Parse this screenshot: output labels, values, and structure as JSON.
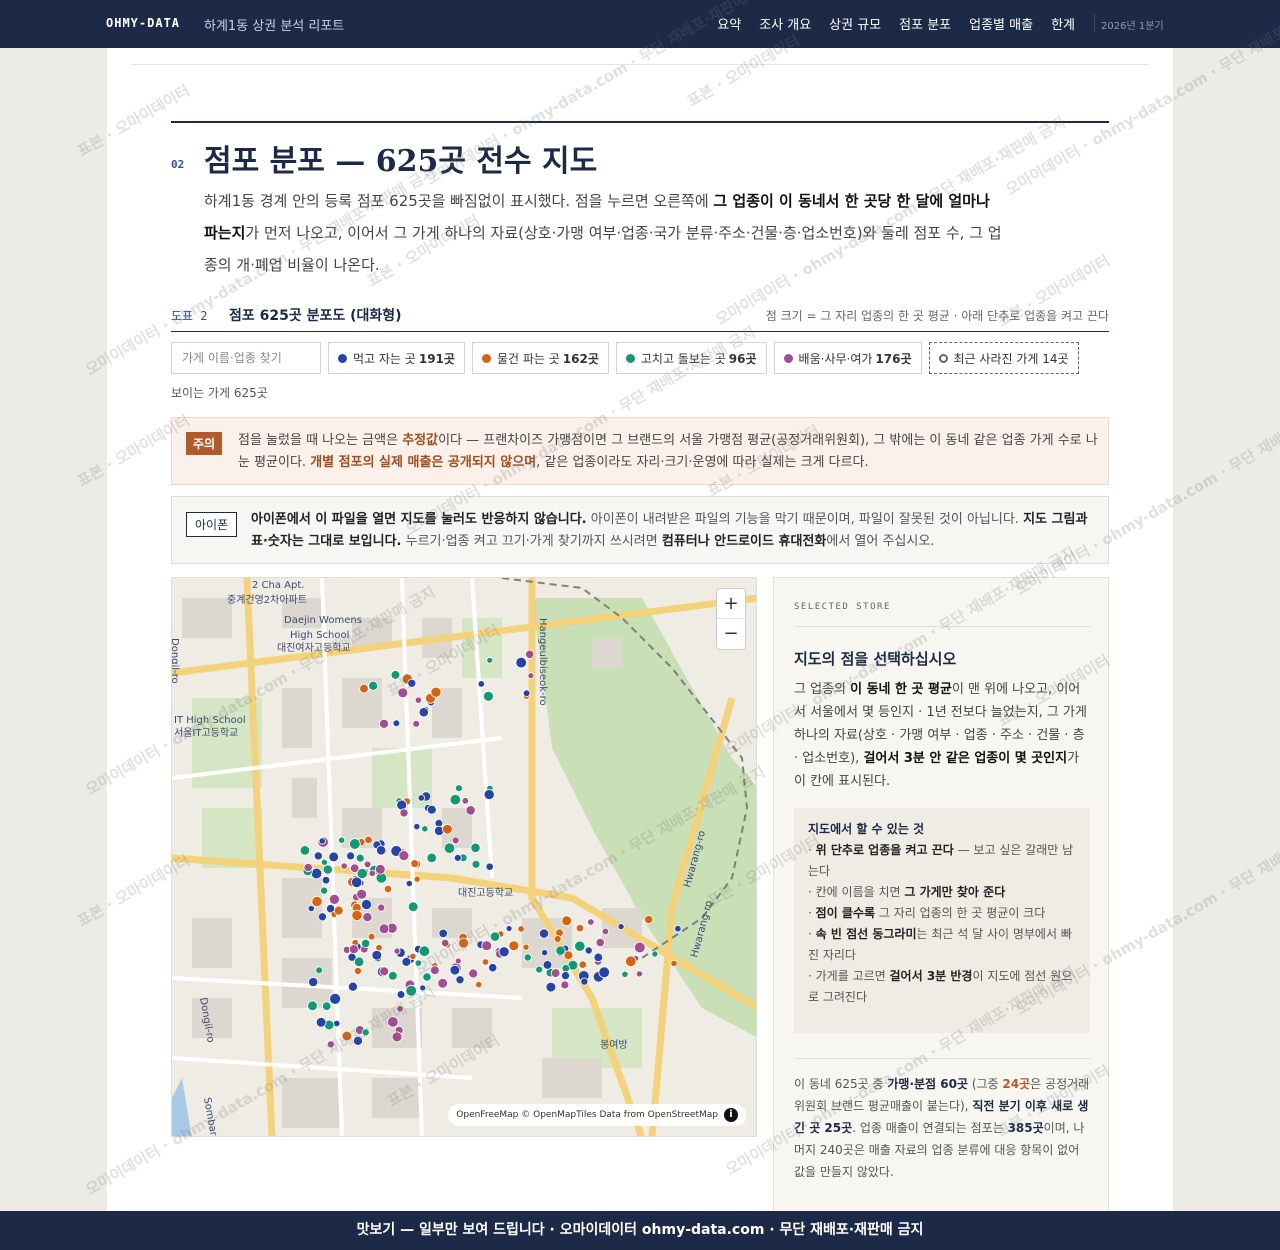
{
  "nav": {
    "brand": "OHMY-DATA",
    "report_title": "하계1동 상권 분석 리포트",
    "items": [
      "요약",
      "조사 개요",
      "상권 규모",
      "점포 분포",
      "업종별 매출",
      "한계"
    ],
    "period": "2026년 1분기"
  },
  "section": {
    "number": "02",
    "title": "점포 분포 — 625곳 전수 지도",
    "desc_1": "하계1동 경계 안의 등록 점포 625곳을 빠짐없이 표시했다. 점을 누르면 오른쪽에 ",
    "desc_bold": "그 업종이 이 동네서 한 곳당 한 달에 얼마나 파는지",
    "desc_2": "가 먼저 나오고, 이어서 그 가게 하나의 자료(상호·가맹 여부·업종·국가 분류·주소·건물·층·업소번호)와 둘레 점포 수, 그 업종의 개·폐업 비율이 나온다."
  },
  "figure": {
    "number": "도표 2",
    "title": "점포 625곳 분포도 (대화형)",
    "note": "점 크기 = 그 자리 업종의 한 곳 평균 · 아래 단추로 업종을 켜고 끈다"
  },
  "filters": {
    "search_placeholder": "가게 이름·업종 찾기",
    "chips": [
      {
        "label": "먹고 자는 곳",
        "count": "191곳",
        "color": "#2644a8"
      },
      {
        "label": "물건 파는 곳",
        "count": "162곳",
        "color": "#d9620f"
      },
      {
        "label": "고치고 돌보는 곳",
        "count": "96곳",
        "color": "#0f9a73"
      },
      {
        "label": "배움·사무·여가",
        "count": "176곳",
        "color": "#a34c90"
      }
    ],
    "closed_chip": "최근 사라진 가게 14곳",
    "visible_count": "보이는 가게 625곳"
  },
  "caution": {
    "tag": "주의",
    "t1": "점을 눌렀을 때 나오는 금액은 ",
    "b1": "추정값",
    "t2": "이다 — 프랜차이즈 가맹점이면 그 브랜드의 서울 가맹점 평균(공정거래위원회), 그 밖에는 이 동네 같은 업종 가게 수로 나눈 평균이다. ",
    "b2": "개별 점포의 실제 매출은 공개되지 않으며",
    "t3": ", 같은 업종이라도 자리·크기·운영에 따라 실제는 크게 다르다."
  },
  "iphone": {
    "tag": "아이폰",
    "b1": "아이폰에서 이 파일을 열면 지도를 눌러도 반응하지 않습니다.",
    "t1": " 아이폰이 내려받은 파일의 기능을 막기 때문이며, 파일이 잘못된 것이 아닙니다. ",
    "b2": "지도 그림과 표·숫자는 그대로 보입니다.",
    "t2": " 누르기·업종 켜고 끄기·가게 찾기까지 쓰시려면 ",
    "b3": "컴퓨터나 안드로이드 휴대전화",
    "t3": "에서 열어 주십시오."
  },
  "map": {
    "labels": [
      "2 Cha Apt.",
      "중계건영2차아파트",
      "Daejin Womens",
      "High School",
      "대진여자고등학교",
      "IT High School",
      "서울IT고등학교",
      "대진고등학교",
      "봉여방",
      "Dongil-ro",
      "Dongil-ro",
      "Sombari-ro",
      "Hwarang-ro",
      "Hwarang-ro",
      "Hangeulbiseok-ro"
    ],
    "zoom_in": "+",
    "zoom_out": "−",
    "attribution": "OpenFreeMap © OpenMapTiles Data from OpenStreetMap",
    "info": "i"
  },
  "side": {
    "label": "SELECTED STORE",
    "title": "지도의 점을 선택하십시오",
    "d1": "그 업종의 ",
    "db1": "이 동네 한 곳 평균",
    "d2": "이 맨 위에 나오고, 이어서 서울에서 몇 등인지 · 1년 전보다 늘었는지, 그 가게 하나의 자료(상호 · 가맹 여부 · 업종 · 주소 · 건물 · 층 · 업소번호), ",
    "db2": "걸어서 3분 안 같은 업종이 몇 곳인지",
    "d3": "가 이 칸에 표시된다.",
    "howto_title": "지도에서 할 수 있는 것",
    "howto": [
      {
        "b": "위 단추로 업종을 켜고 끈다",
        "t": " — 보고 싶은 갈래만 남는다"
      },
      {
        "t0": "칸에 이름을 치면 ",
        "b": "그 가게만 찾아 준다",
        "t": ""
      },
      {
        "b": "점이 클수록",
        "t": " 그 자리 업종의 한 곳 평균이 크다"
      },
      {
        "b": "속 빈 점선 동그라미",
        "t": "는 최근 석 달 사이 명부에서 빠진 자리다"
      },
      {
        "t0": "가게를 고르면 ",
        "b": "걸어서 3분 반경",
        "t": "이 지도에 점선 원으로 그려진다"
      }
    ],
    "s1": "이 동네 625곳 중 ",
    "sb1": "가맹·분점 60곳",
    "s2": " (그중 ",
    "sb2": "24곳",
    "s3": "은 공정거래위원회 브랜드 평균매출이 붙는다), ",
    "sb3": "직전 분기 이후 새로 생긴 곳 25곳",
    "s4": ". 업종 매출이 연결되는 점포는 ",
    "sb4": "385곳",
    "s5": "이며, 나머지 240곳은 매출 자료의 업종 분류에 대응 항목이 없어 값을 만들지 않았다."
  },
  "watermarks": [
    "표본 · 오마이데이터",
    "오마이데이터 · ohmy-data.com · 무단 재배포·재판매 금지"
  ],
  "footer": "맛보기 — 일부만 보여 드립니다 · 오마이데이터 ohmy-data.com · 무단 재배포·재판매 금지"
}
